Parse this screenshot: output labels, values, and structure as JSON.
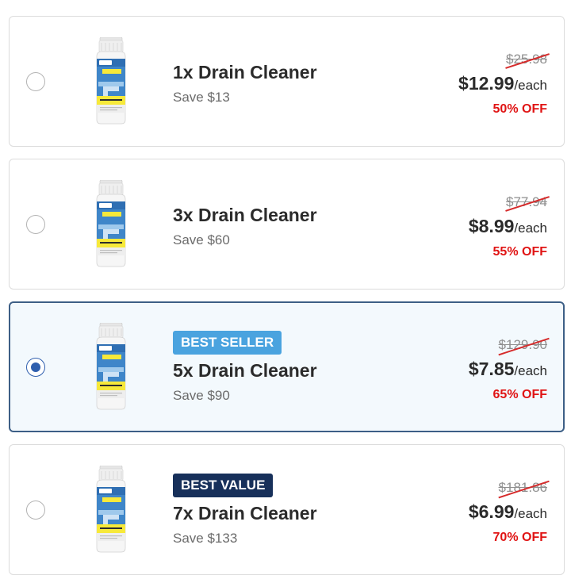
{
  "offers": [
    {
      "title": "1x Drain Cleaner",
      "save": "Save $13",
      "badge": "",
      "old_price": "$25.98",
      "price": "$12.99",
      "per": "/each",
      "discount": "50% OFF",
      "selected": false,
      "product_brand": "WALO",
      "product_label": "VALUE PACK!"
    },
    {
      "title": "3x Drain Cleaner",
      "save": "Save $60",
      "badge": "",
      "old_price": "$77.94",
      "price": "$8.99",
      "per": "/each",
      "discount": "55% OFF",
      "selected": false,
      "product_brand": "WALO",
      "product_label": "VALUE PACK!"
    },
    {
      "title": "5x Drain Cleaner",
      "save": "Save $90",
      "badge": "BEST SELLER",
      "old_price": "$129.90",
      "price": "$7.85",
      "per": "/each",
      "discount": "65% OFF",
      "selected": true,
      "product_brand": "WALO",
      "product_label": "VALUE PACK!"
    },
    {
      "title": "7x Drain Cleaner",
      "save": "Save $133",
      "badge": "BEST VALUE",
      "old_price": "$181.86",
      "price": "$6.99",
      "per": "/each",
      "discount": "70% OFF",
      "selected": false,
      "product_brand": "WALO",
      "product_label": "VALUE PACK!"
    }
  ],
  "colors": {
    "selected_border": "#3d5f86",
    "selected_bg": "#f3f9fd",
    "radio_active": "#2f5fae",
    "best_seller_badge": "#4aa3df",
    "best_value_badge": "#17305a",
    "discount_text": "#e01414",
    "strike_line": "#d62b2b"
  },
  "icons": {
    "radio": "radio-button",
    "product": "drain-cleaner-bottle-image"
  }
}
